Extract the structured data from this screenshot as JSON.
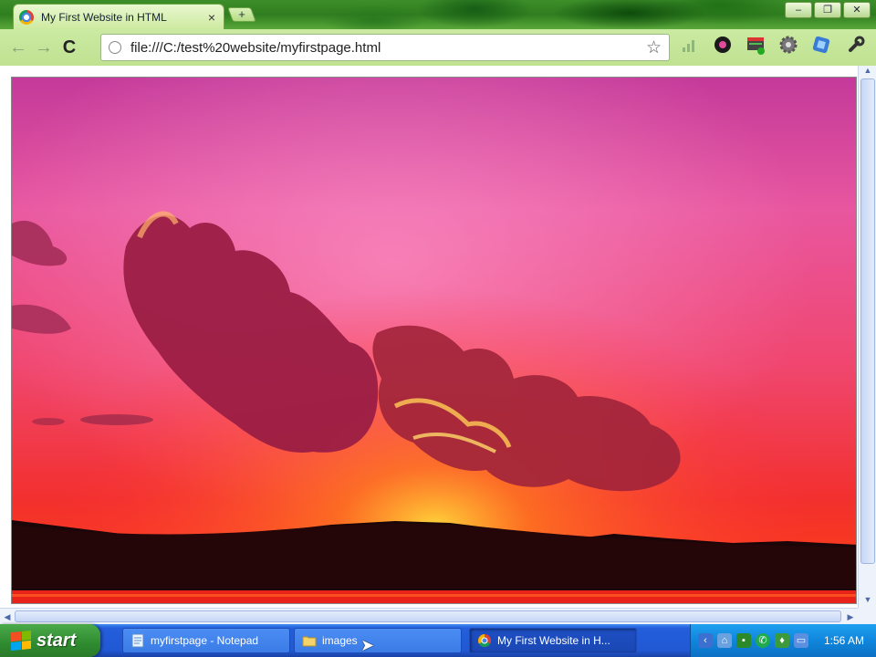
{
  "browser": {
    "tab_title": "My First Website in HTML",
    "tab_close": "×",
    "new_tab": "+",
    "window_buttons": {
      "minimize": "–",
      "maximize": "❐",
      "close": "✕"
    },
    "nav": {
      "back": "←",
      "forward": "→",
      "reload": "C"
    },
    "url": "file:///C:/test%20website/myfirstpage.html",
    "star": "☆"
  },
  "taskbar": {
    "start_label": "start",
    "tasks": [
      {
        "label": "myfirstpage - Notepad",
        "active": false
      },
      {
        "label": "images",
        "active": false
      },
      {
        "label": "My First Website in H...",
        "active": true
      }
    ],
    "clock": "1:56 AM"
  },
  "colors": {
    "chrome_green": "#bfe290",
    "taskbar_blue": "#245edb",
    "start_green": "#3c9a3c",
    "tray_blue": "#0f86dc"
  }
}
